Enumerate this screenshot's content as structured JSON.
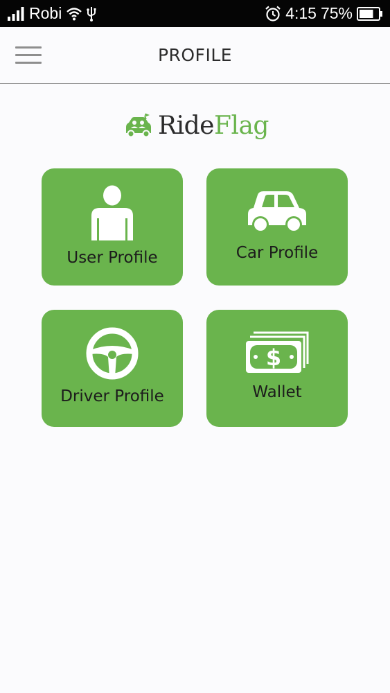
{
  "status_bar": {
    "carrier": "Robi",
    "time": "4:15",
    "battery": "75%",
    "battery_level": 0.75,
    "icons": [
      "signal-icon",
      "wifi-icon",
      "usb-icon",
      "alarm-icon",
      "battery-icon"
    ]
  },
  "header": {
    "title": "PROFILE",
    "menu_icon": "hamburger-menu-icon"
  },
  "logo": {
    "part_ride": "Ride",
    "part_flag": "Flag",
    "brand_color": "#6ab44d",
    "icon": "car-with-passengers-logo-icon"
  },
  "tiles": [
    {
      "label": "User Profile",
      "icon": "user-icon"
    },
    {
      "label": "Car Profile",
      "icon": "car-icon"
    },
    {
      "label": "Driver Profile",
      "icon": "steering-wheel-icon"
    },
    {
      "label": "Wallet",
      "icon": "money-icon"
    }
  ],
  "colors": {
    "tile_background": "#6ab44d",
    "status_bar": "#050505",
    "page_background": "#fbfbfd"
  }
}
